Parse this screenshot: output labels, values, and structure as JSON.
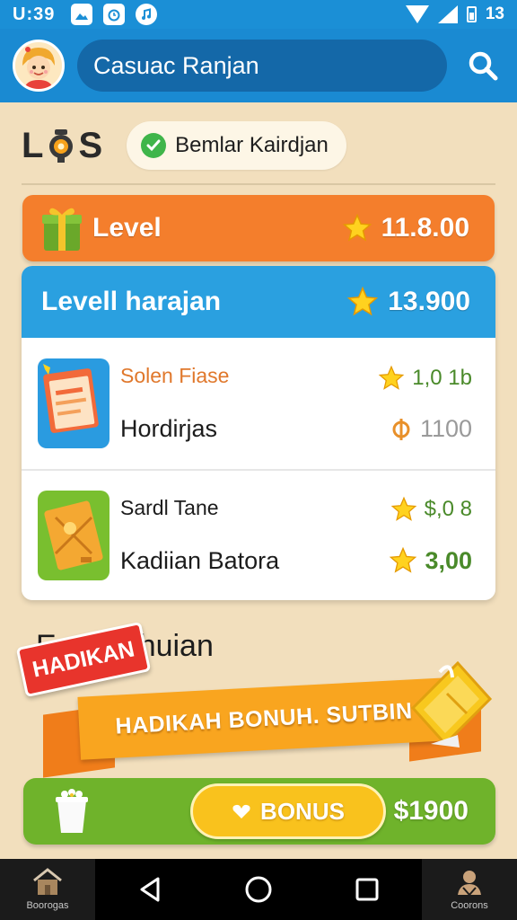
{
  "status_bar": {
    "time": "U:39",
    "battery_text": "13",
    "notif_icons": [
      "image-icon",
      "alarm-icon",
      "music-icon"
    ]
  },
  "header": {
    "search_text": "Casuac Ranjan",
    "search_icon": "search-icon",
    "avatar": "avatar-icon"
  },
  "title_row": {
    "logo_left": "L",
    "logo_right": "S",
    "chip_label": "Bemlar Kairdjan"
  },
  "level_bar": {
    "label": "Level",
    "value": "11.8.00",
    "color": "#f47e2c"
  },
  "card": {
    "title": "Levell harajan",
    "value": "13.900",
    "color": "#2aa0e0",
    "rows": [
      {
        "sub_label": "Solen Fiase",
        "main_label": "Hordirjas",
        "value_1": "1,0 1b",
        "value_2": "1100",
        "icon": "document-folder-icon"
      },
      {
        "sub_label": "Sardl Tane",
        "main_label": "Kadiian Batora",
        "value_1": "$,0 8",
        "value_2": "3,00",
        "icon": "ticket-folder-icon"
      }
    ]
  },
  "promo": {
    "heading_left": "E",
    "heading_right": "huian",
    "badge": "HADIKAN",
    "banner": "HADIKAH BONUH. SUTBIN"
  },
  "bonus_bar": {
    "button_label": "BONUS",
    "amount": "$1900",
    "color": "#6fb32b"
  },
  "nav": {
    "left_label": "Boorogas",
    "right_label": "Coorons"
  }
}
